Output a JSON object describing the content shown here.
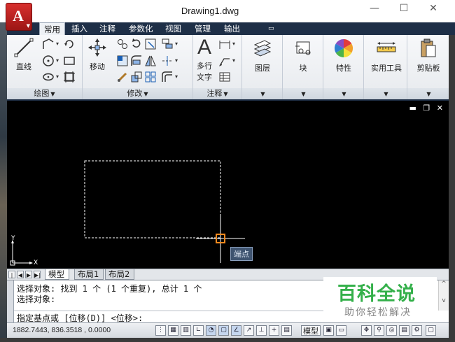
{
  "app": {
    "title": "Drawing1.dwg",
    "logo_letter": "A",
    "window_controls": {
      "minimize": "—",
      "maximize": "☐",
      "close": "✕"
    }
  },
  "ribbon_tabs": [
    {
      "label": "常用",
      "active": true
    },
    {
      "label": "插入"
    },
    {
      "label": "注释"
    },
    {
      "label": "参数化"
    },
    {
      "label": "视图"
    },
    {
      "label": "管理"
    },
    {
      "label": "输出"
    }
  ],
  "ribbon": {
    "draw": {
      "title": "绘图",
      "line_label": "直线"
    },
    "modify": {
      "title": "修改",
      "move_label": "移动"
    },
    "annotation": {
      "title": "注释",
      "mtext_label_1": "多行",
      "mtext_label_2": "文字"
    },
    "layers": {
      "label": "图层"
    },
    "block": {
      "label": "块"
    },
    "properties": {
      "label": "特性"
    },
    "utilities": {
      "label": "实用工具"
    },
    "clipboard": {
      "label": "剪贴板"
    }
  },
  "viewport": {
    "controls": {
      "minimize": "▬",
      "restore": "❐",
      "close": "✕"
    },
    "snap_tooltip": "端点",
    "ucs_x": "X",
    "ucs_y": "Y"
  },
  "layout_tabs": [
    {
      "label": "模型",
      "active": true
    },
    {
      "label": "布局1"
    },
    {
      "label": "布局2"
    }
  ],
  "command": {
    "history": [
      "选择对象: 找到 1 个 (1 个重复), 总计 1 个",
      "选择对象:"
    ],
    "prompt": "指定基点或 [位移(D)] <位移>:"
  },
  "watermark": {
    "title": "百科全说",
    "subtitle": "助你轻松解决"
  },
  "status": {
    "coordinates": "1882.7443, 836.3518 , 0.0000",
    "model_label": "模型"
  },
  "colors": {
    "title_tab_bg": "#1e2f47",
    "canvas_bg": "#000000",
    "app_button": "#c42421",
    "watermark_green": "#34b04a",
    "snap_marker": "#ff8a1e"
  }
}
